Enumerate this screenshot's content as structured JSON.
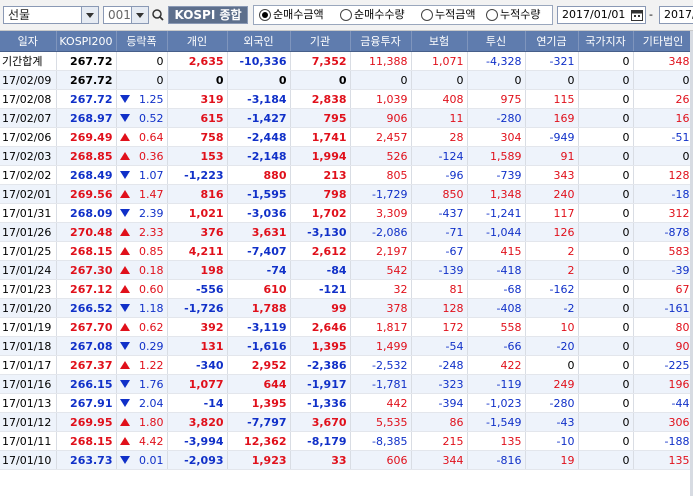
{
  "toolbar": {
    "market_select": "선물",
    "code_select": "001",
    "index_name": "KOSPI 종합",
    "radio_options": [
      "순매수금액",
      "순매수수량",
      "누적금액",
      "누적수량"
    ],
    "radio_selected": 0,
    "start_date": "2017/01/01",
    "date_separator": "-",
    "end_date": "2017/"
  },
  "table": {
    "headers": [
      "일자",
      "KOSPI200",
      "등락폭",
      "개인",
      "외국인",
      "기관",
      "금융투자",
      "보험",
      "투신",
      "연기금",
      "국가지자",
      "기타법인"
    ],
    "rows": [
      {
        "date": "기간합계",
        "kospi": "267.72",
        "dir": "none",
        "chg": "0",
        "ind": "2,635",
        "for": "-10,336",
        "inst": "7,352",
        "fin": "11,388",
        "ins": "1,071",
        "trust": "-4,328",
        "pen": "-321",
        "gov": "0",
        "etc": "348"
      },
      {
        "date": "17/02/09",
        "kospi": "267.72",
        "dir": "none",
        "chg": "0",
        "ind": "0",
        "for": "0",
        "inst": "0",
        "fin": "0",
        "ins": "0",
        "trust": "0",
        "pen": "0",
        "gov": "0",
        "etc": "0"
      },
      {
        "date": "17/02/08",
        "kospi": "267.72",
        "dir": "down",
        "chg": "1.25",
        "ind": "319",
        "for": "-3,184",
        "inst": "2,838",
        "fin": "1,039",
        "ins": "408",
        "trust": "975",
        "pen": "115",
        "gov": "0",
        "etc": "26"
      },
      {
        "date": "17/02/07",
        "kospi": "268.97",
        "dir": "down",
        "chg": "0.52",
        "ind": "615",
        "for": "-1,427",
        "inst": "795",
        "fin": "906",
        "ins": "11",
        "trust": "-280",
        "pen": "169",
        "gov": "0",
        "etc": "16"
      },
      {
        "date": "17/02/06",
        "kospi": "269.49",
        "dir": "up",
        "chg": "0.64",
        "ind": "758",
        "for": "-2,448",
        "inst": "1,741",
        "fin": "2,457",
        "ins": "28",
        "trust": "304",
        "pen": "-949",
        "gov": "0",
        "etc": "-51"
      },
      {
        "date": "17/02/03",
        "kospi": "268.85",
        "dir": "up",
        "chg": "0.36",
        "ind": "153",
        "for": "-2,148",
        "inst": "1,994",
        "fin": "526",
        "ins": "-124",
        "trust": "1,589",
        "pen": "91",
        "gov": "0",
        "etc": "0"
      },
      {
        "date": "17/02/02",
        "kospi": "268.49",
        "dir": "down",
        "chg": "1.07",
        "ind": "-1,223",
        "for": "880",
        "inst": "213",
        "fin": "805",
        "ins": "-96",
        "trust": "-739",
        "pen": "343",
        "gov": "0",
        "etc": "128"
      },
      {
        "date": "17/02/01",
        "kospi": "269.56",
        "dir": "up",
        "chg": "1.47",
        "ind": "816",
        "for": "-1,595",
        "inst": "798",
        "fin": "-1,729",
        "ins": "850",
        "trust": "1,348",
        "pen": "240",
        "gov": "0",
        "etc": "-18"
      },
      {
        "date": "17/01/31",
        "kospi": "268.09",
        "dir": "down",
        "chg": "2.39",
        "ind": "1,021",
        "for": "-3,036",
        "inst": "1,702",
        "fin": "3,309",
        "ins": "-437",
        "trust": "-1,241",
        "pen": "117",
        "gov": "0",
        "etc": "312"
      },
      {
        "date": "17/01/26",
        "kospi": "270.48",
        "dir": "up",
        "chg": "2.33",
        "ind": "376",
        "for": "3,631",
        "inst": "-3,130",
        "fin": "-2,086",
        "ins": "-71",
        "trust": "-1,044",
        "pen": "126",
        "gov": "0",
        "etc": "-878"
      },
      {
        "date": "17/01/25",
        "kospi": "268.15",
        "dir": "up",
        "chg": "0.85",
        "ind": "4,211",
        "for": "-7,407",
        "inst": "2,612",
        "fin": "2,197",
        "ins": "-67",
        "trust": "415",
        "pen": "2",
        "gov": "0",
        "etc": "583"
      },
      {
        "date": "17/01/24",
        "kospi": "267.30",
        "dir": "up",
        "chg": "0.18",
        "ind": "198",
        "for": "-74",
        "inst": "-84",
        "fin": "542",
        "ins": "-139",
        "trust": "-418",
        "pen": "2",
        "gov": "0",
        "etc": "-39"
      },
      {
        "date": "17/01/23",
        "kospi": "267.12",
        "dir": "up",
        "chg": "0.60",
        "ind": "-556",
        "for": "610",
        "inst": "-121",
        "fin": "32",
        "ins": "81",
        "trust": "-68",
        "pen": "-162",
        "gov": "0",
        "etc": "67"
      },
      {
        "date": "17/01/20",
        "kospi": "266.52",
        "dir": "down",
        "chg": "1.18",
        "ind": "-1,726",
        "for": "1,788",
        "inst": "99",
        "fin": "378",
        "ins": "128",
        "trust": "-408",
        "pen": "-2",
        "gov": "0",
        "etc": "-161"
      },
      {
        "date": "17/01/19",
        "kospi": "267.70",
        "dir": "up",
        "chg": "0.62",
        "ind": "392",
        "for": "-3,119",
        "inst": "2,646",
        "fin": "1,817",
        "ins": "172",
        "trust": "558",
        "pen": "10",
        "gov": "0",
        "etc": "80"
      },
      {
        "date": "17/01/18",
        "kospi": "267.08",
        "dir": "down",
        "chg": "0.29",
        "ind": "131",
        "for": "-1,616",
        "inst": "1,395",
        "fin": "1,499",
        "ins": "-54",
        "trust": "-66",
        "pen": "-20",
        "gov": "0",
        "etc": "90"
      },
      {
        "date": "17/01/17",
        "kospi": "267.37",
        "dir": "up",
        "chg": "1.22",
        "ind": "-340",
        "for": "2,952",
        "inst": "-2,386",
        "fin": "-2,532",
        "ins": "-248",
        "trust": "422",
        "pen": "0",
        "gov": "0",
        "etc": "-225"
      },
      {
        "date": "17/01/16",
        "kospi": "266.15",
        "dir": "down",
        "chg": "1.76",
        "ind": "1,077",
        "for": "644",
        "inst": "-1,917",
        "fin": "-1,781",
        "ins": "-323",
        "trust": "-119",
        "pen": "249",
        "gov": "0",
        "etc": "196"
      },
      {
        "date": "17/01/13",
        "kospi": "267.91",
        "dir": "down",
        "chg": "2.04",
        "ind": "-14",
        "for": "1,395",
        "inst": "-1,336",
        "fin": "442",
        "ins": "-394",
        "trust": "-1,023",
        "pen": "-280",
        "gov": "0",
        "etc": "-44"
      },
      {
        "date": "17/01/12",
        "kospi": "269.95",
        "dir": "up",
        "chg": "1.80",
        "ind": "3,820",
        "for": "-7,797",
        "inst": "3,670",
        "fin": "5,535",
        "ins": "86",
        "trust": "-1,549",
        "pen": "-43",
        "gov": "0",
        "etc": "306"
      },
      {
        "date": "17/01/11",
        "kospi": "268.15",
        "dir": "up",
        "chg": "4.42",
        "ind": "-3,994",
        "for": "12,362",
        "inst": "-8,179",
        "fin": "-8,385",
        "ins": "215",
        "trust": "135",
        "pen": "-10",
        "gov": "0",
        "etc": "-188"
      },
      {
        "date": "17/01/10",
        "kospi": "263.73",
        "dir": "down",
        "chg": "0.01",
        "ind": "-2,093",
        "for": "1,923",
        "inst": "33",
        "fin": "606",
        "ins": "344",
        "trust": "-816",
        "pen": "19",
        "gov": "0",
        "etc": "135"
      }
    ]
  },
  "colors": {
    "positive": "#e0101b",
    "negative": "#1030c8",
    "header_bg": "#5f7cae",
    "alt_row_bg": "#eef3fb"
  }
}
